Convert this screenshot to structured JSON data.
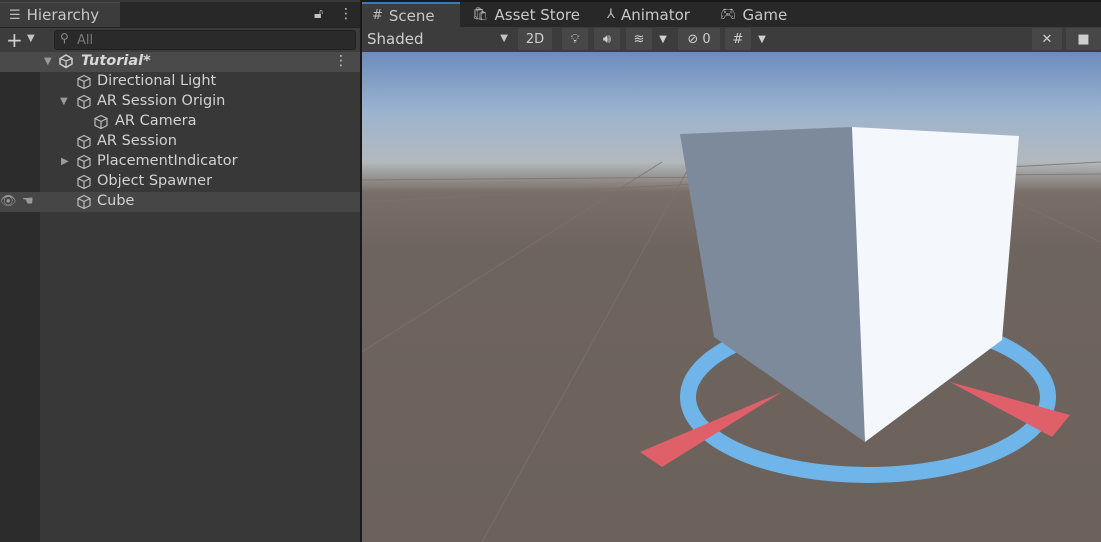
{
  "hierarchy": {
    "tab_label": "Hierarchy",
    "search_placeholder": "All",
    "scene_name": "Tutorial*",
    "items": [
      {
        "label": "Directional Light"
      },
      {
        "label": "AR Session Origin"
      },
      {
        "label": "AR Camera"
      },
      {
        "label": "AR Session"
      },
      {
        "label": "PlacementIndicator"
      },
      {
        "label": "Object Spawner"
      },
      {
        "label": "Cube"
      }
    ]
  },
  "tabs": [
    {
      "label": "Scene"
    },
    {
      "label": "Asset Store"
    },
    {
      "label": "Animator"
    },
    {
      "label": "Game"
    }
  ],
  "scene_toolbar": {
    "draw_mode": "Shaded",
    "mode_2d": "2D",
    "hidden_count": "0"
  },
  "colors": {
    "accent": "#3a79bb",
    "ring": "#6fb5ea",
    "arrows": "#e0606a"
  }
}
